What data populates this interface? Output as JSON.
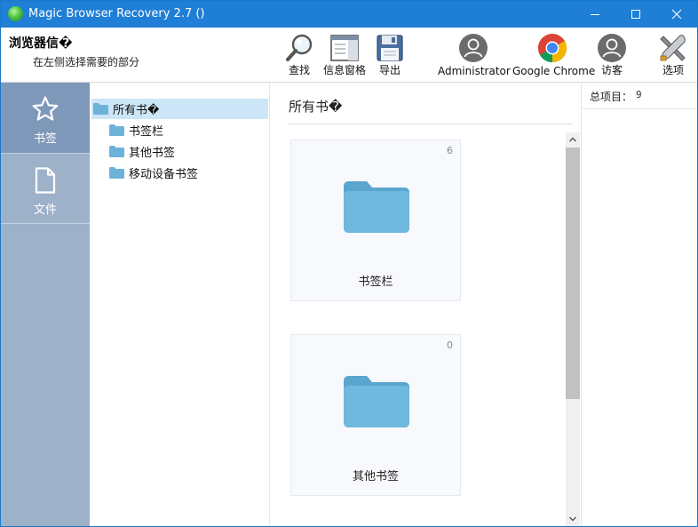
{
  "window": {
    "title": "Magic Browser Recovery 2.7 ()",
    "controls": {
      "minimize": "minimize-icon",
      "maximize": "maximize-icon",
      "close": "close-icon"
    }
  },
  "header": {
    "title": "浏览器信�",
    "subtitle": "在左侧选择需要的部分"
  },
  "toolbar": {
    "buttons": [
      {
        "label": "查找",
        "icon": "magnifier-icon"
      },
      {
        "label": "信息窗格",
        "icon": "info-pane-icon"
      },
      {
        "label": "导出",
        "icon": "floppy-disk-icon"
      },
      {
        "label": "Administrator",
        "icon": "user-avatar-icon"
      },
      {
        "label": "Google Chrome",
        "icon": "chrome-icon"
      },
      {
        "label": "访客",
        "icon": "user-avatar-icon"
      },
      {
        "label": "选项",
        "icon": "tools-icon"
      }
    ]
  },
  "nav": {
    "items": [
      {
        "label": "书签",
        "icon": "star-icon",
        "active": true
      },
      {
        "label": "文件",
        "icon": "file-icon",
        "active": false
      }
    ]
  },
  "tree": {
    "root": "所有书�",
    "children": [
      "书签栏",
      "其他书签",
      "移动设备书签"
    ]
  },
  "content": {
    "title": "所有书�",
    "cards": [
      {
        "label": "书签栏",
        "count": "6"
      },
      {
        "label": "其他书签",
        "count": "0"
      }
    ]
  },
  "info": {
    "total_label": "总项目：",
    "total_value": "9"
  },
  "colors": {
    "titlebar": "#1f7fd6",
    "nav_bg": "#9db1c9",
    "nav_active": "#7e98b9",
    "folder": "#6db3d9",
    "tree_selected": "#cde6f7"
  }
}
